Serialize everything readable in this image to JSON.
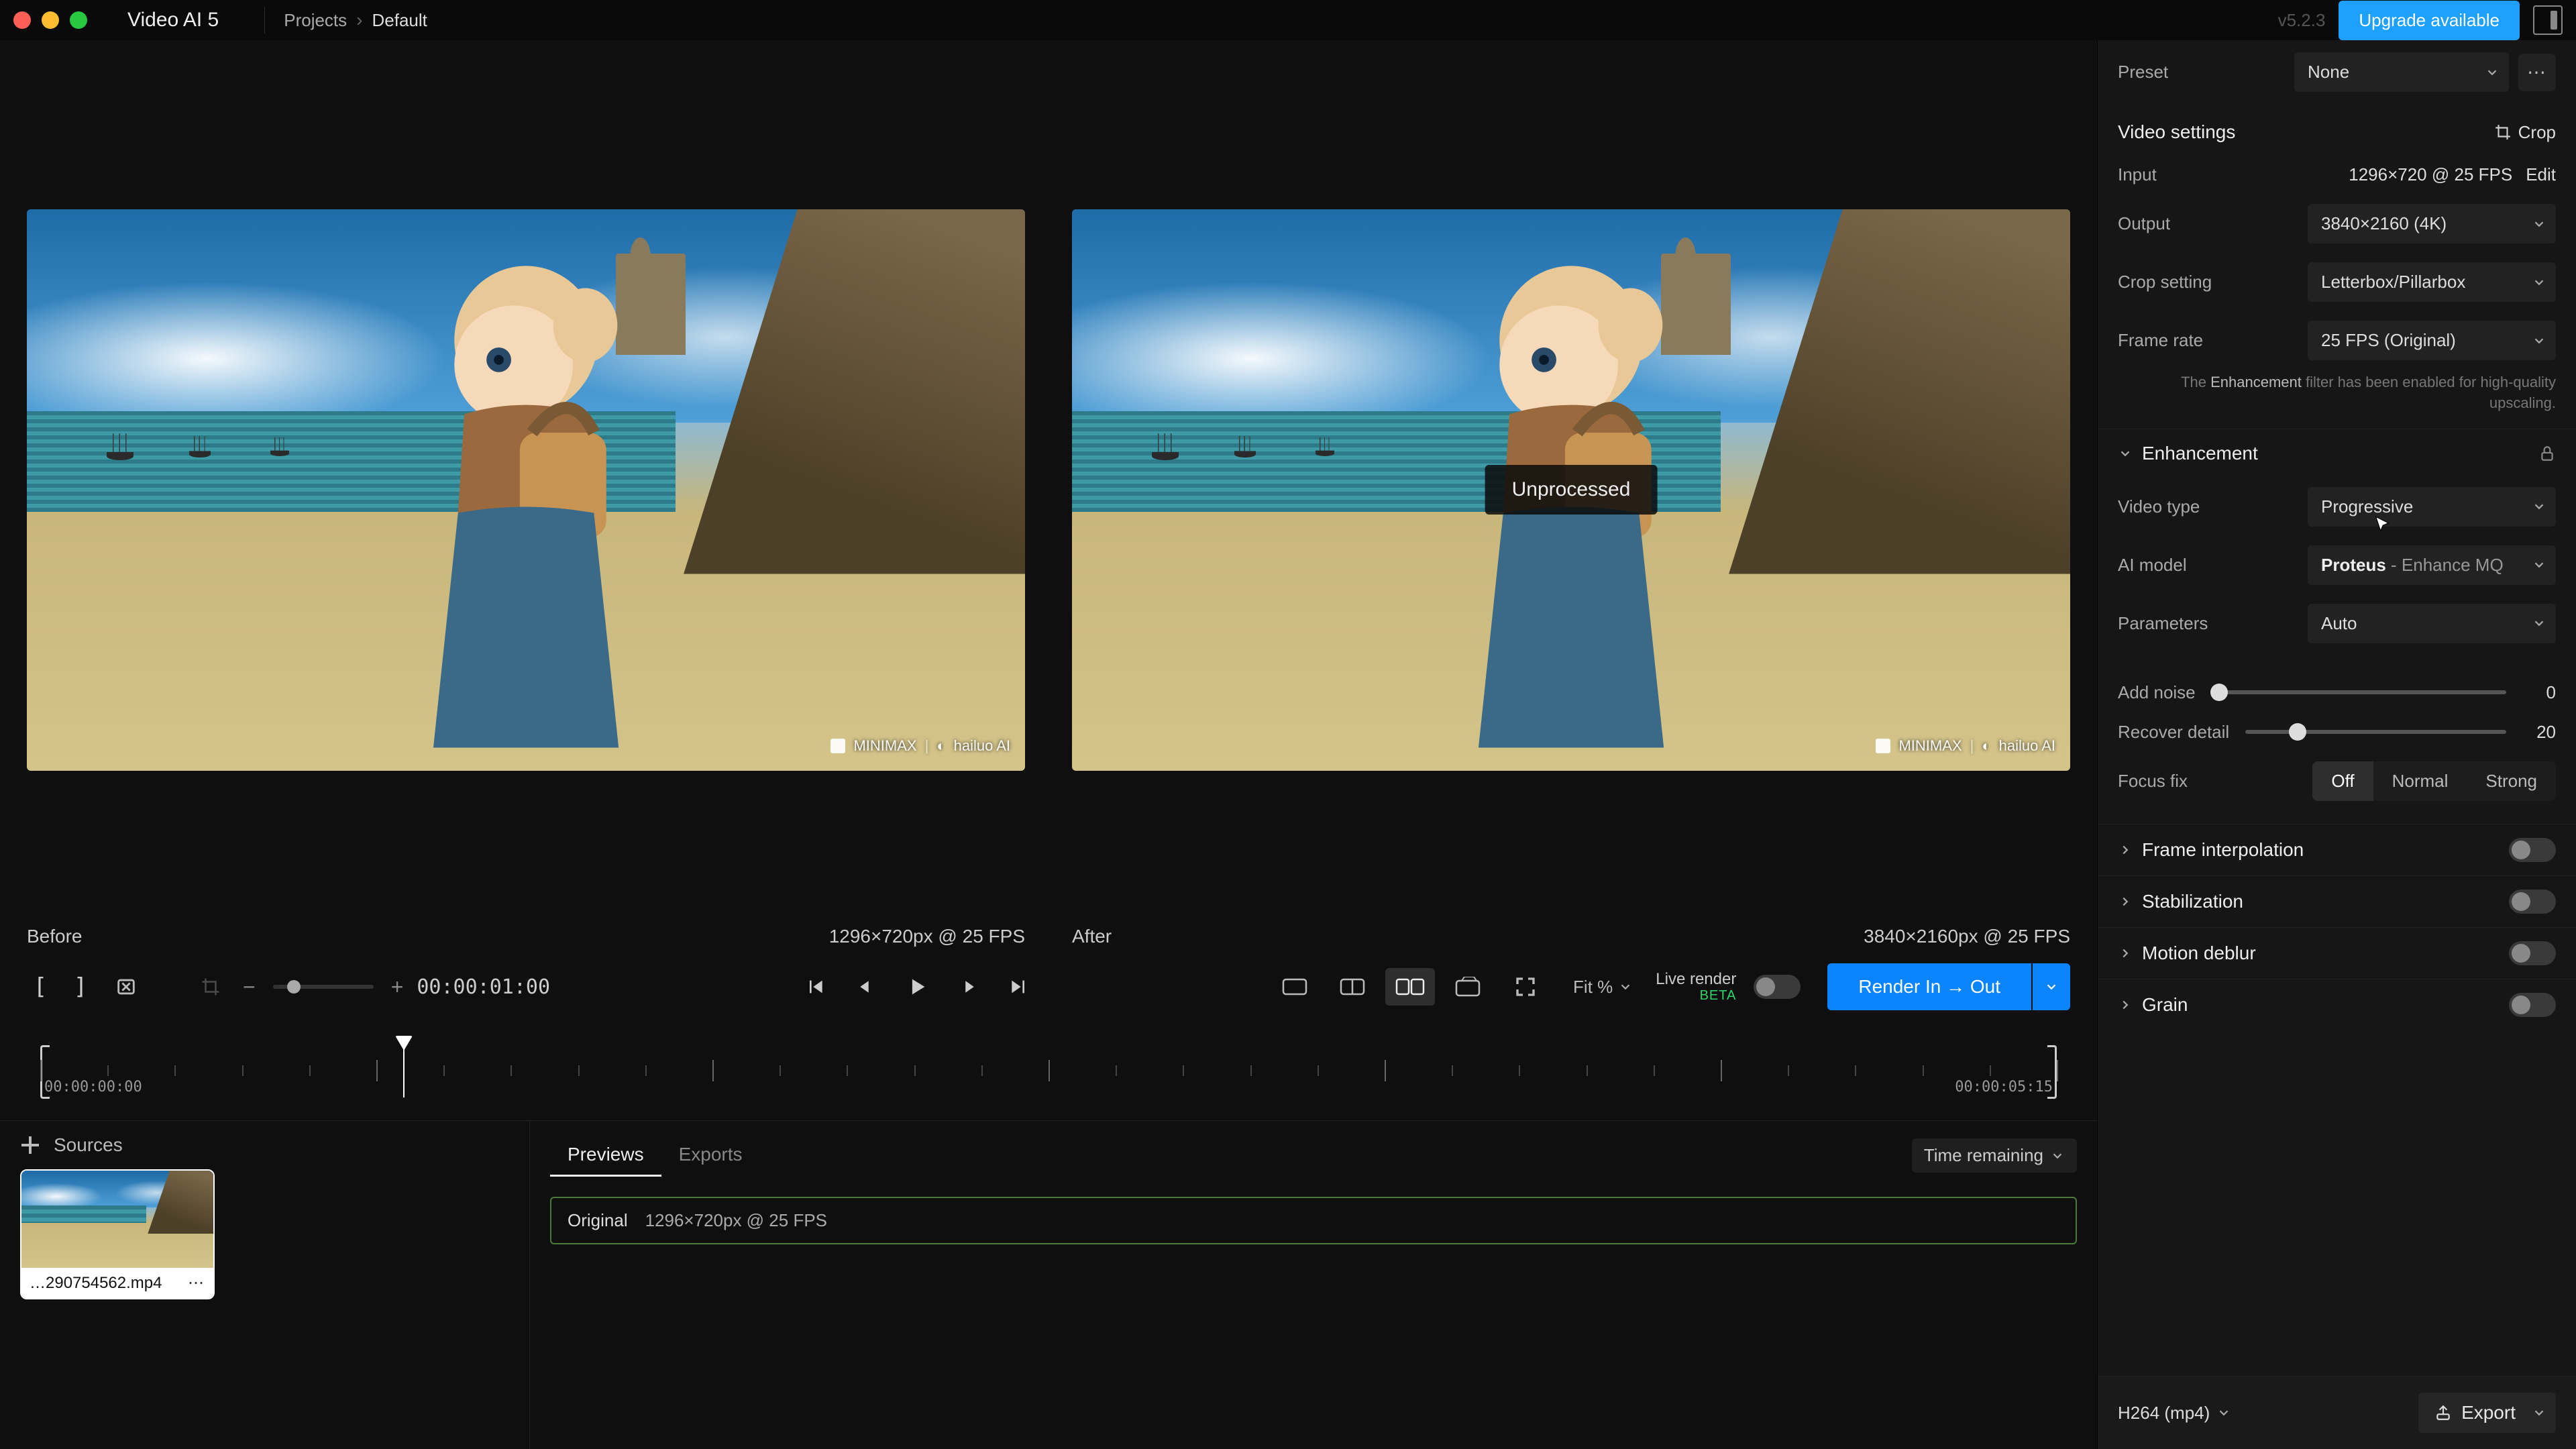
{
  "titlebar": {
    "app": "Video AI  5",
    "projects": "Projects",
    "project": "Default",
    "version": "v5.2.3",
    "upgrade": "Upgrade available"
  },
  "preview": {
    "before": "Before",
    "after": "After",
    "before_spec": "1296×720px @ 25 FPS",
    "after_spec": "3840×2160px @ 25 FPS",
    "unprocessed": "Unprocessed",
    "watermark1": "MINIMAX",
    "watermark2": "hailuo AI"
  },
  "transport": {
    "timecode": "00:00:01:00",
    "fit": "Fit %",
    "live": "Live render",
    "beta": "BETA",
    "render": "Render In → Out"
  },
  "timeline": {
    "start": "00:00:00:00",
    "end": "00:00:05:15",
    "playhead_pct": 18
  },
  "sources": {
    "title": "Sources",
    "clip_name": "…290754562.mp4"
  },
  "jobs": {
    "tab_previews": "Previews",
    "tab_exports": "Exports",
    "time_remaining": "Time remaining",
    "row_name": "Original",
    "row_spec": "1296×720px @ 25 FPS"
  },
  "panel": {
    "preset_label": "Preset",
    "preset_value": "None",
    "video_settings": "Video settings",
    "crop": "Crop",
    "input_label": "Input",
    "input_value": "1296×720 @ 25 FPS",
    "edit": "Edit",
    "output_label": "Output",
    "output_value": "3840×2160 (4K)",
    "cropset_label": "Crop setting",
    "cropset_value": "Letterbox/Pillarbox",
    "framerate_label": "Frame rate",
    "framerate_value": "25 FPS (Original)",
    "note_pre": "The ",
    "note_bold": "Enhancement",
    "note_post": " filter has been enabled for high-quality upscaling.",
    "enhancement": "Enhancement",
    "video_type_label": "Video type",
    "video_type_value": "Progressive",
    "ai_model_label": "AI model",
    "ai_model_value": "Proteus",
    "ai_model_sub": " - Enhance MQ",
    "params_label": "Parameters",
    "params_value": "Auto",
    "addnoise_label": "Add noise",
    "addnoise_value": "0",
    "recover_label": "Recover detail",
    "recover_value": "20",
    "focus_label": "Focus fix",
    "focus_off": "Off",
    "focus_normal": "Normal",
    "focus_strong": "Strong",
    "frame_interp": "Frame interpolation",
    "stabilization": "Stabilization",
    "motion_deblur": "Motion deblur",
    "grain": "Grain",
    "format": "H264 (mp4)",
    "export": "Export"
  }
}
